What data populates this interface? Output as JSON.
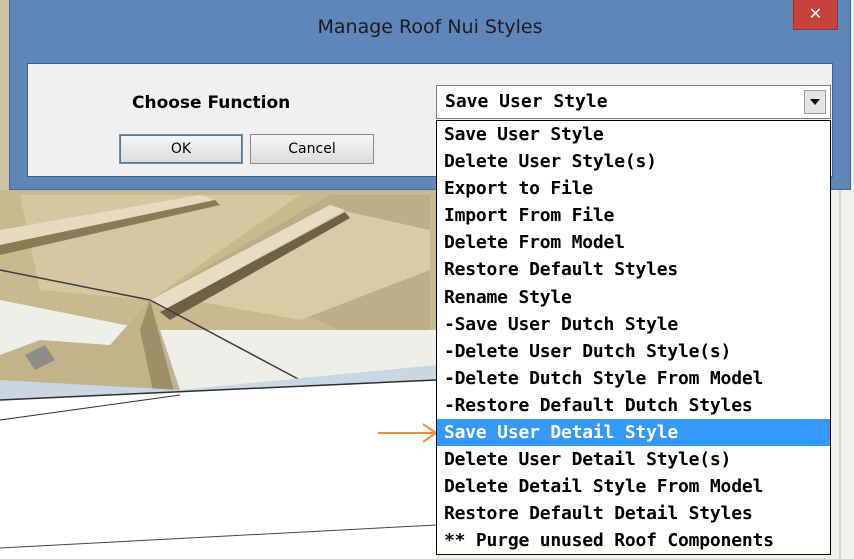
{
  "dialog": {
    "title": "Manage Roof Nui Styles",
    "close_glyph": "✕",
    "close_icon": "close-icon",
    "choose_label": "Choose Function",
    "ok_label": "OK",
    "cancel_label": "Cancel"
  },
  "combo": {
    "selected_value": "Save User Style",
    "arrow_icon": "chevron-down-icon"
  },
  "options": [
    "Save User Style",
    "Delete User Style(s)",
    "Export to File",
    "Import From File",
    "Delete From Model",
    "Restore Default Styles",
    "Rename Style",
    "-Save User Dutch Style",
    "-Delete User Dutch Style(s)",
    "-Delete Dutch Style From Model",
    "-Restore Default Dutch Styles",
    "Save User Detail Style",
    "Delete User Detail Style(s)",
    "Delete Detail Style From Model",
    "Restore Default Detail Styles",
    "** Purge unused Roof Components"
  ],
  "highlighted_option": "Save User Detail Style",
  "annotation": {
    "arrow_icon": "arrow-right-icon",
    "color": "#f08a3c"
  },
  "colors": {
    "titlebar": "#5d87b7",
    "close": "#c7423b",
    "selection": "#3399ff"
  }
}
